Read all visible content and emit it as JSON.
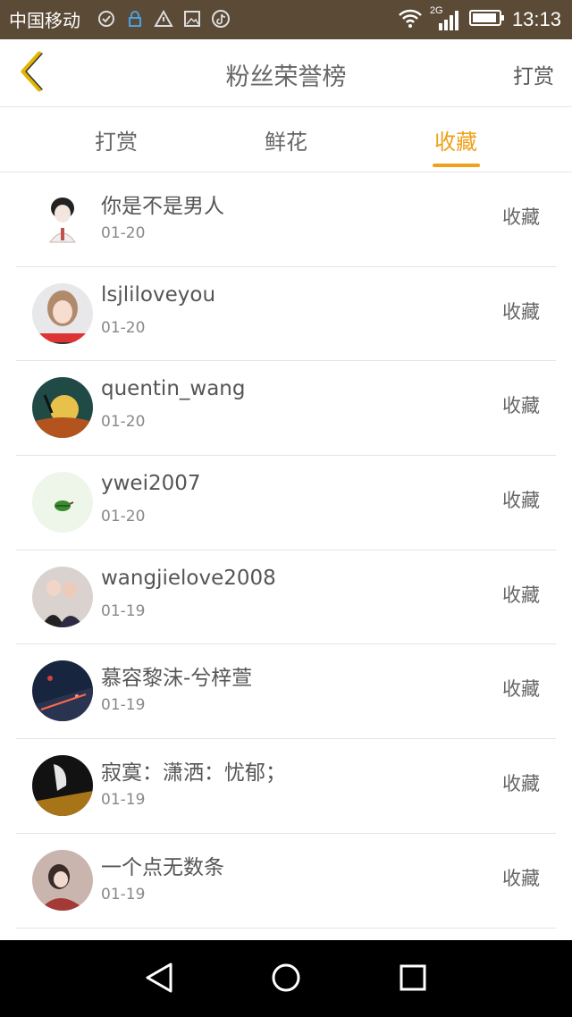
{
  "status_bar": {
    "carrier": "中国移动",
    "network": "2G",
    "time": "13:13"
  },
  "header": {
    "title": "粉丝荣誉榜",
    "right_action": "打赏"
  },
  "tabs": [
    {
      "label": "打赏",
      "active": false
    },
    {
      "label": "鲜花",
      "active": false
    },
    {
      "label": "收藏",
      "active": true
    }
  ],
  "accent_color": "#f0a019",
  "fans": [
    {
      "name": "你是不是男人",
      "date": "01-20",
      "action": "收藏"
    },
    {
      "name": "lsjliloveyou",
      "date": "01-20",
      "action": "收藏"
    },
    {
      "name": "quentin_wang",
      "date": "01-20",
      "action": "收藏"
    },
    {
      "name": "ywei2007",
      "date": "01-20",
      "action": "收藏"
    },
    {
      "name": "wangjielove2008",
      "date": "01-19",
      "action": "收藏"
    },
    {
      "name": "慕容黎沫-兮梓萱",
      "date": "01-19",
      "action": "收藏"
    },
    {
      "name": "寂寞：潇洒：忧郁；",
      "date": "01-19",
      "action": "收藏"
    },
    {
      "name": "一个点无数条",
      "date": "01-19",
      "action": "收藏"
    }
  ]
}
